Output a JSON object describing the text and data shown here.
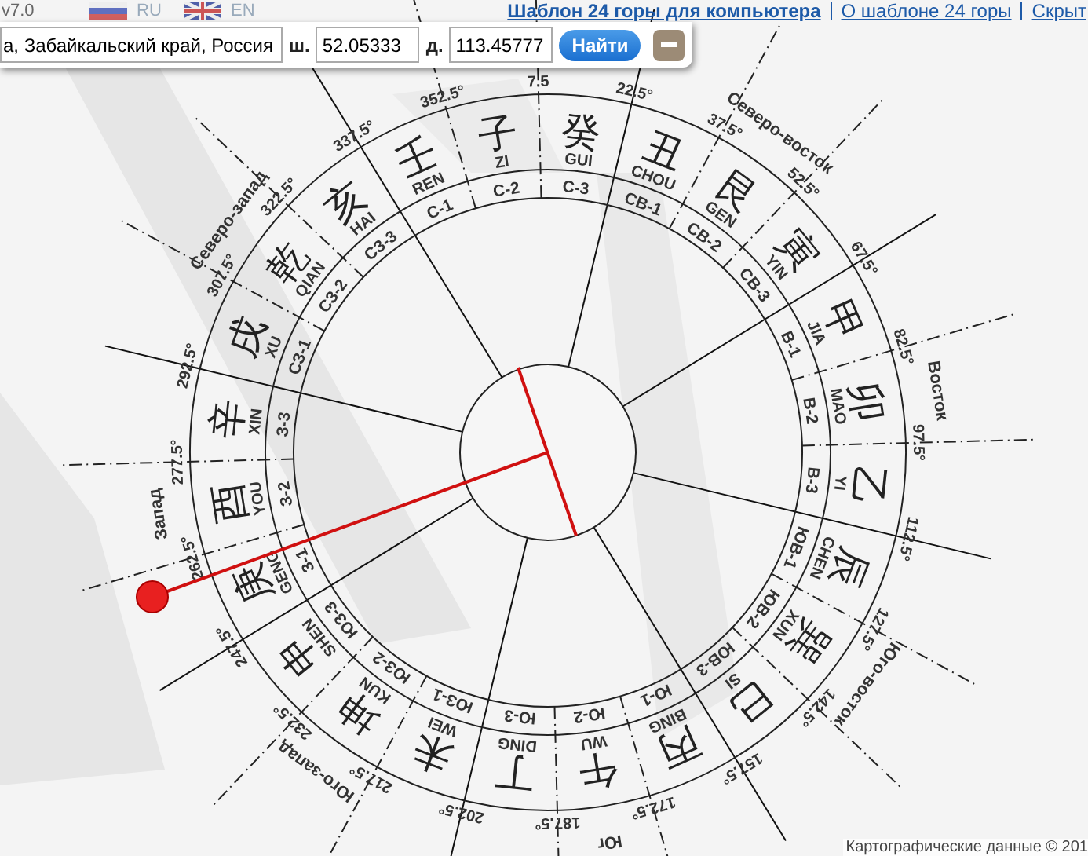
{
  "header": {
    "version": "v7.0",
    "languages": [
      {
        "label": "RU",
        "kind": "ru"
      },
      {
        "label": "EN",
        "kind": "en"
      }
    ],
    "links": [
      {
        "label": "Шаблон 24 горы для компьютера",
        "bold": true
      },
      {
        "label": "О шаблоне 24 горы",
        "bold": false
      },
      {
        "label": "Скрыт",
        "bold": false
      }
    ]
  },
  "search": {
    "address": "а, Забайкальский край, Россия",
    "lat_label": "ш.",
    "lat": "52.05333",
    "lon_label": "д.",
    "lon": "113.45777",
    "button": "Найти"
  },
  "compass": {
    "mountains": [
      {
        "char": "子",
        "pinyin": "ZI",
        "sector": "С-2"
      },
      {
        "char": "癸",
        "pinyin": "GUI",
        "sector": "С-3"
      },
      {
        "char": "丑",
        "pinyin": "CHOU",
        "sector": "СВ-1"
      },
      {
        "char": "艮",
        "pinyin": "GEN",
        "sector": "СВ-2"
      },
      {
        "char": "寅",
        "pinyin": "YIN",
        "sector": "СВ-3"
      },
      {
        "char": "甲",
        "pinyin": "JIA",
        "sector": "В-1"
      },
      {
        "char": "卯",
        "pinyin": "MAO",
        "sector": "В-2"
      },
      {
        "char": "乙",
        "pinyin": "YI",
        "sector": "В-3"
      },
      {
        "char": "辰",
        "pinyin": "CHEN",
        "sector": "ЮВ-1"
      },
      {
        "char": "巽",
        "pinyin": "XUN",
        "sector": "ЮВ-2"
      },
      {
        "char": "巳",
        "pinyin": "SI",
        "sector": "ЮВ-3"
      },
      {
        "char": "丙",
        "pinyin": "BING",
        "sector": "Ю-1"
      },
      {
        "char": "午",
        "pinyin": "WU",
        "sector": "Ю-2"
      },
      {
        "char": "丁",
        "pinyin": "DING",
        "sector": "Ю-3"
      },
      {
        "char": "未",
        "pinyin": "WEI",
        "sector": "ЮЗ-1"
      },
      {
        "char": "坤",
        "pinyin": "KUN",
        "sector": "ЮЗ-2"
      },
      {
        "char": "申",
        "pinyin": "SHEN",
        "sector": "ЮЗ-3"
      },
      {
        "char": "庚",
        "pinyin": "GENG",
        "sector": "З-1"
      },
      {
        "char": "酉",
        "pinyin": "YOU",
        "sector": "З-2"
      },
      {
        "char": "辛",
        "pinyin": "XIN",
        "sector": "З-3"
      },
      {
        "char": "戌",
        "pinyin": "XU",
        "sector": "СЗ-1"
      },
      {
        "char": "乾",
        "pinyin": "QIAN",
        "sector": "СЗ-2"
      },
      {
        "char": "亥",
        "pinyin": "HAI",
        "sector": "СЗ-3"
      },
      {
        "char": "壬",
        "pinyin": "REN",
        "sector": "С-1"
      }
    ],
    "degrees": [
      "7.5",
      "22.5°",
      "37.5°",
      "52.5°",
      "67.5°",
      "82.5°",
      "97.5°",
      "112.5°",
      "127.5°",
      "142.5°",
      "157.5°",
      "172.5°",
      "187.5°",
      "202.5°",
      "217.5°",
      "232.5°",
      "247.5°",
      "262.5°",
      "277.5°",
      "292.5°",
      "307.5°",
      "322.5°",
      "337.5°",
      "352.5°"
    ],
    "directions": [
      "Северо-восток",
      "Восток",
      "Юго-восток",
      "Юг",
      "Юго-запад",
      "Запад",
      "Северо-запад"
    ]
  },
  "attribution": "Картографические данные © 201"
}
